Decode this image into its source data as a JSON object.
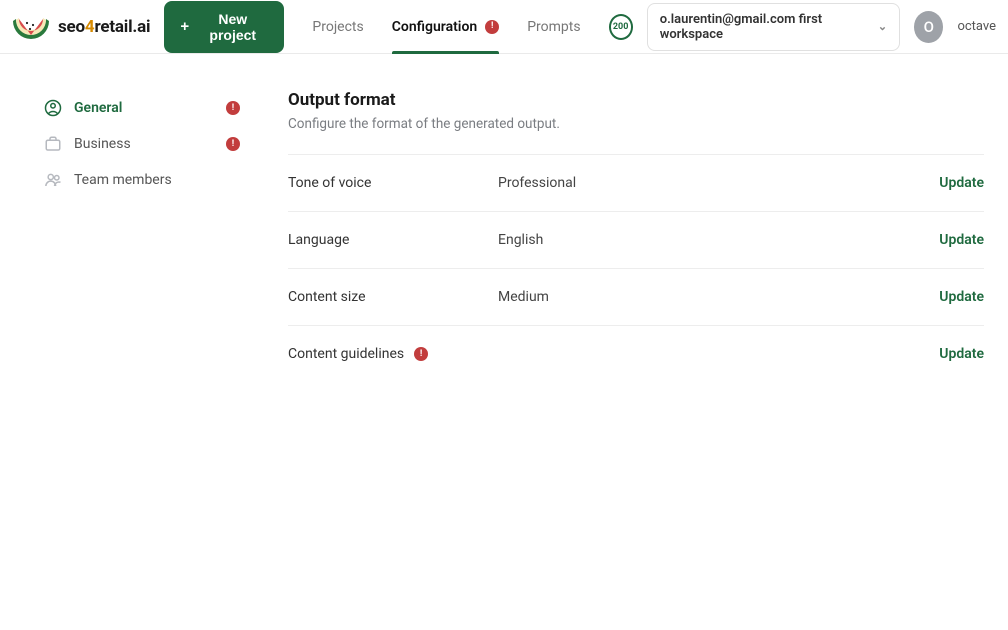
{
  "brand": {
    "name_pre": "seo",
    "name_accent": "4",
    "name_post": "retail.ai"
  },
  "header": {
    "new_project_label": "New project",
    "credits": "200",
    "workspace_label": "o.laurentin@gmail.com first workspace",
    "avatar_initial": "O",
    "username": "octave",
    "tabs": [
      {
        "label": "Projects",
        "active": false,
        "alert": false
      },
      {
        "label": "Configuration",
        "active": true,
        "alert": true
      },
      {
        "label": "Prompts",
        "active": false,
        "alert": false
      }
    ]
  },
  "sidebar": {
    "items": [
      {
        "label": "General",
        "active": true,
        "alert": true,
        "icon": "user-circle"
      },
      {
        "label": "Business",
        "active": false,
        "alert": true,
        "icon": "briefcase"
      },
      {
        "label": "Team members",
        "active": false,
        "alert": false,
        "icon": "users"
      }
    ]
  },
  "section": {
    "title": "Output format",
    "description": "Configure the format of the generated output.",
    "update_label": "Update",
    "rows": [
      {
        "key": "Tone of voice",
        "value": "Professional",
        "alert": false
      },
      {
        "key": "Language",
        "value": "English",
        "alert": false
      },
      {
        "key": "Content size",
        "value": "Medium",
        "alert": false
      },
      {
        "key": "Content guidelines",
        "value": "",
        "alert": true
      }
    ]
  }
}
